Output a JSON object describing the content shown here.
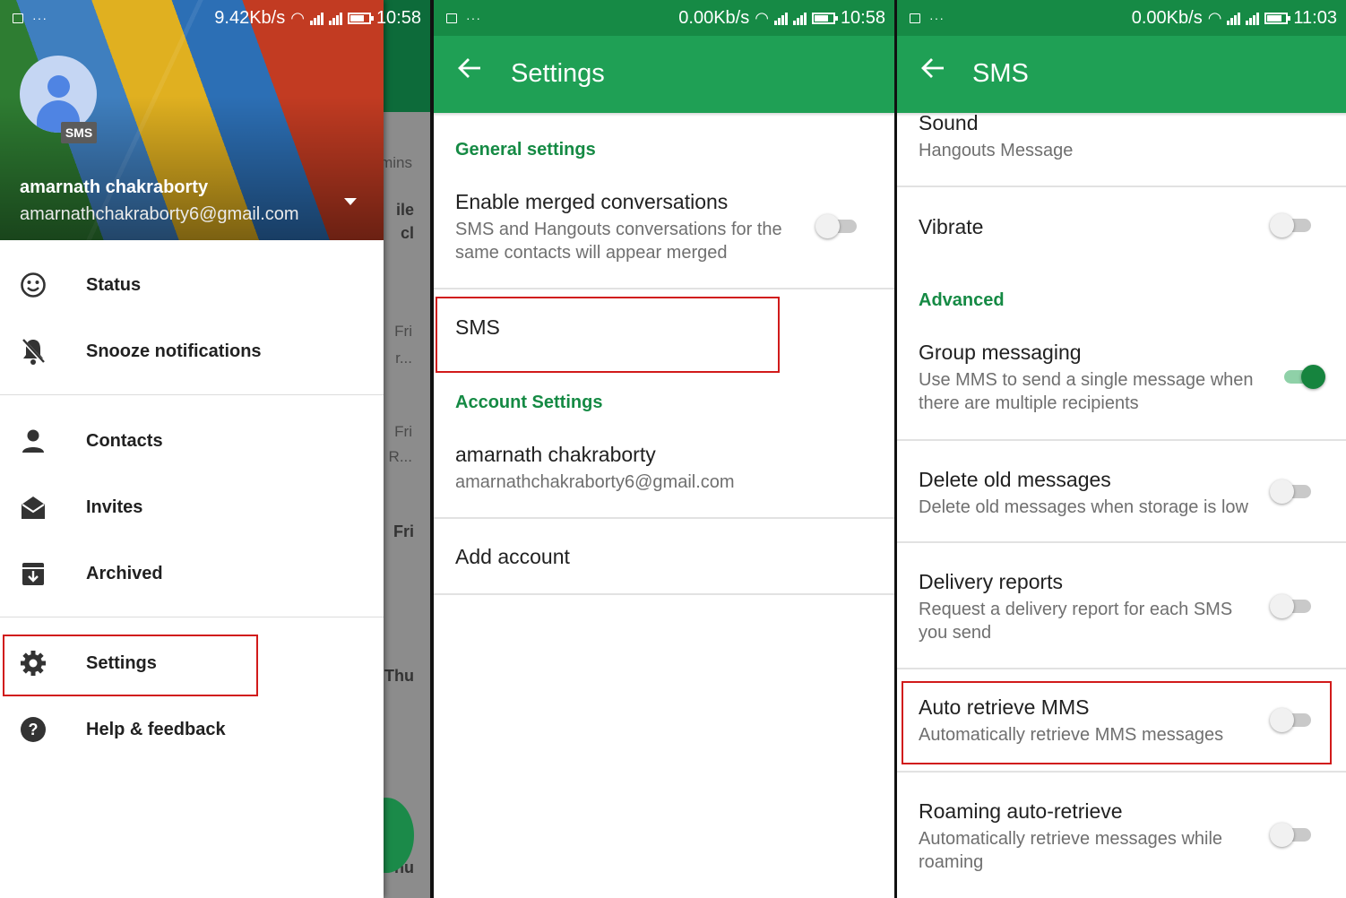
{
  "colors": {
    "primary": "#1fa055",
    "primary_dark": "#168a45",
    "accent": "#16843e",
    "section_header": "#158a44",
    "highlight_box": "#d11a1a"
  },
  "panels": [
    {
      "id": "navigation-drawer",
      "status_bar": {
        "speed": "9.42Kb/s",
        "time": "10:58",
        "battery_percent": 70
      },
      "account": {
        "avatar_badge": "SMS",
        "name": "amarnath chakraborty",
        "email": "amarnathchakraborty6@gmail.com"
      },
      "menu": [
        {
          "label": "Status",
          "icon": "smiley-icon"
        },
        {
          "label": "Snooze notifications",
          "icon": "bell-off-icon"
        },
        {
          "label": "Contacts",
          "icon": "person-icon"
        },
        {
          "label": "Invites",
          "icon": "envelope-open-icon"
        },
        {
          "label": "Archived",
          "icon": "archive-icon"
        },
        {
          "label": "Settings",
          "icon": "gear-icon",
          "highlighted": true
        },
        {
          "label": "Help & feedback",
          "icon": "help-icon"
        }
      ],
      "background_list": {
        "fragments": [
          "mins",
          "ile",
          "cl",
          "Fri",
          "r...",
          "Fri",
          "R...",
          "Fri",
          "Thu",
          "nu"
        ]
      }
    },
    {
      "id": "settings-screen",
      "status_bar": {
        "speed": "0.00Kb/s",
        "time": "10:58",
        "battery_percent": 70
      },
      "title": "Settings",
      "sections": [
        {
          "header": "General settings",
          "items": [
            {
              "title": "Enable merged conversations",
              "summary": "SMS and Hangouts conversations for the same contacts will appear merged",
              "summary_lines": [
                "SMS and Hangouts conversations for the",
                "same contacts will appear merged"
              ],
              "switch": false
            }
          ]
        },
        {
          "header": "",
          "items": [
            {
              "title": "SMS",
              "highlighted": true
            }
          ]
        },
        {
          "header": "Account Settings",
          "items": [
            {
              "title": "amarnath chakraborty",
              "summary": "amarnathchakraborty6@gmail.com"
            },
            {
              "title": "Add account"
            }
          ]
        }
      ]
    },
    {
      "id": "sms-settings-screen",
      "status_bar": {
        "speed": "0.00Kb/s",
        "time": "11:03",
        "battery_percent": 70
      },
      "title": "SMS",
      "items_top": [
        {
          "title": "Sound",
          "summary": "Hangouts Message"
        },
        {
          "title": "Vibrate",
          "switch": false
        }
      ],
      "advanced_header": "Advanced",
      "items_advanced": [
        {
          "title": "Group messaging",
          "summary_lines": [
            "Use MMS to send a single message when",
            "there are multiple recipients"
          ],
          "switch": true
        },
        {
          "title": "Delete old messages",
          "summary_lines": [
            "Delete old messages when storage is low"
          ],
          "switch": false
        },
        {
          "title": "Delivery reports",
          "summary_lines": [
            "Request a delivery report for each SMS",
            "you send"
          ],
          "switch": false
        },
        {
          "title": "Auto retrieve MMS",
          "summary_lines": [
            "Automatically retrieve MMS messages"
          ],
          "switch": false,
          "highlighted": true
        },
        {
          "title": "Roaming auto-retrieve",
          "summary_lines": [
            "Automatically retrieve messages while",
            "roaming"
          ],
          "switch": false
        }
      ]
    }
  ]
}
